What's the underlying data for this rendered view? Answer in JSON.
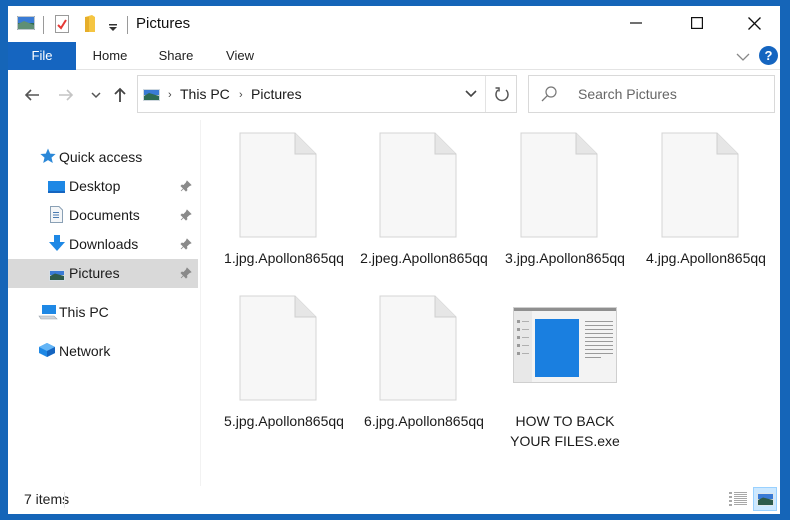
{
  "window": {
    "title": "Pictures",
    "controls": {
      "minimize": "—",
      "maximize": "☐",
      "close": "✕"
    }
  },
  "ribbon": {
    "tabs": [
      {
        "label": "File",
        "active": true
      },
      {
        "label": "Home"
      },
      {
        "label": "Share"
      },
      {
        "label": "View"
      }
    ],
    "help_label": "?"
  },
  "navigation": {
    "breadcrumb": [
      "This PC",
      "Pictures"
    ],
    "search_placeholder": "Search Pictures"
  },
  "sidebar": {
    "items": [
      {
        "label": "Quick access",
        "icon": "star-icon"
      },
      {
        "label": "Desktop",
        "icon": "desktop-icon",
        "pinned": true
      },
      {
        "label": "Documents",
        "icon": "documents-icon",
        "pinned": true
      },
      {
        "label": "Downloads",
        "icon": "downloads-icon",
        "pinned": true
      },
      {
        "label": "Pictures",
        "icon": "pictures-icon",
        "pinned": true,
        "selected": true
      },
      {
        "label": "This PC",
        "icon": "computer-icon"
      },
      {
        "label": "Network",
        "icon": "network-icon"
      }
    ]
  },
  "files": [
    {
      "name": "1.jpg.Apollon865qq",
      "type": "blank-file"
    },
    {
      "name": "2.jpeg.Apollon865qq",
      "type": "blank-file"
    },
    {
      "name": "3.jpg.Apollon865qq",
      "type": "blank-file"
    },
    {
      "name": "4.jpg.Apollon865qq",
      "type": "blank-file"
    },
    {
      "name": "5.jpg.Apollon865qq",
      "type": "blank-file"
    },
    {
      "name": "6.jpg.Apollon865qq",
      "type": "blank-file"
    },
    {
      "name": "HOW TO BACK YOUR FILES.exe",
      "type": "exe-thumbnail"
    }
  ],
  "status": {
    "item_count": "7 items"
  },
  "colors": {
    "accent": "#1565c0",
    "selection": "#d9d9d9",
    "view_active_bg": "#cce8ff"
  }
}
